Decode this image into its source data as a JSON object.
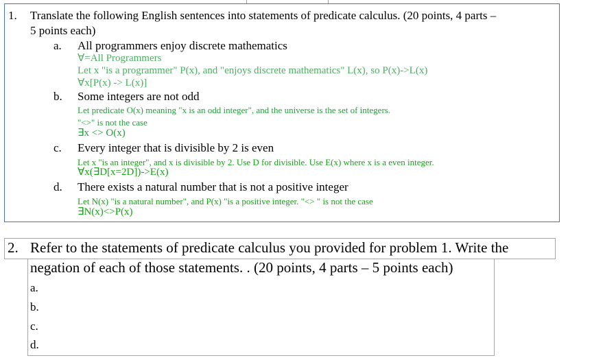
{
  "question1": {
    "number": "1.",
    "text_line1": "Translate the following English sentences into statements of predicate calculus. (20 points, 4 parts –",
    "text_line2": "5 points each)",
    "parts": [
      {
        "letter": "a.",
        "prompt": "All programmers enjoy discrete mathematics",
        "answer_lines": [
          "∀=All Programmers",
          "Let x \"is a programmer\" P(x), and \"enjoys discrete mathematics\" L(x), so P(x)->L(x)",
          "∀x[P(x) -> L(x)]"
        ]
      },
      {
        "letter": "b.",
        "prompt": "Some integers are not odd",
        "answer_lines": [
          "Let predicate O(x) meaning \"x is an odd integer\", and the universe is the set of integers.",
          "\"<>\" is not the case",
          "∃x <> O(x)"
        ]
      },
      {
        "letter": "c.",
        "prompt": "Every integer that is divisible by 2 is even",
        "answer_lines": [
          "Let x \"is an integer\", and x is divisible by 2.  Use D for divisible. Use E(x) where x is a even integer.",
          "∀x(∃D[x=2D])->E(x)"
        ]
      },
      {
        "letter": "d.",
        "prompt": "There exists a natural number that is not a positive integer",
        "answer_lines": [
          "Let N(x) \"is a natural number\", and P(x) \"is a positive integer. \"<> \" is not the case",
          "∃N(x)<>P(x)"
        ]
      }
    ]
  },
  "question2": {
    "number": "2.",
    "text_line1": "Refer to the statements of predicate calculus you provided for problem 1. Write the",
    "text_line2": "negation of each of those statements. . (20 points, 4 parts – 5 points each)",
    "answers": [
      "a.",
      "b.",
      "c.",
      "d."
    ]
  }
}
